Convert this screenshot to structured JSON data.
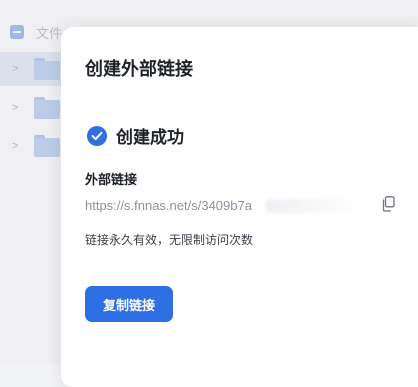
{
  "background": {
    "header_label": "文件",
    "rows": [
      {
        "chevron": ">"
      },
      {
        "chevron": ">"
      },
      {
        "chevron": ">"
      }
    ]
  },
  "dialog": {
    "title": "创建外部链接",
    "status_text": "创建成功",
    "link_label": "外部链接",
    "link_url": "https://s.fnnas.net/s/3409b7a",
    "link_description": "链接永久有效，无限制访问次数",
    "copy_button_label": "复制链接",
    "icons": {
      "status": "check-circle-icon",
      "copy": "copy-icon"
    },
    "colors": {
      "accent": "#2f6fe4",
      "title": "#1f2329",
      "link": "#8d939d"
    }
  }
}
